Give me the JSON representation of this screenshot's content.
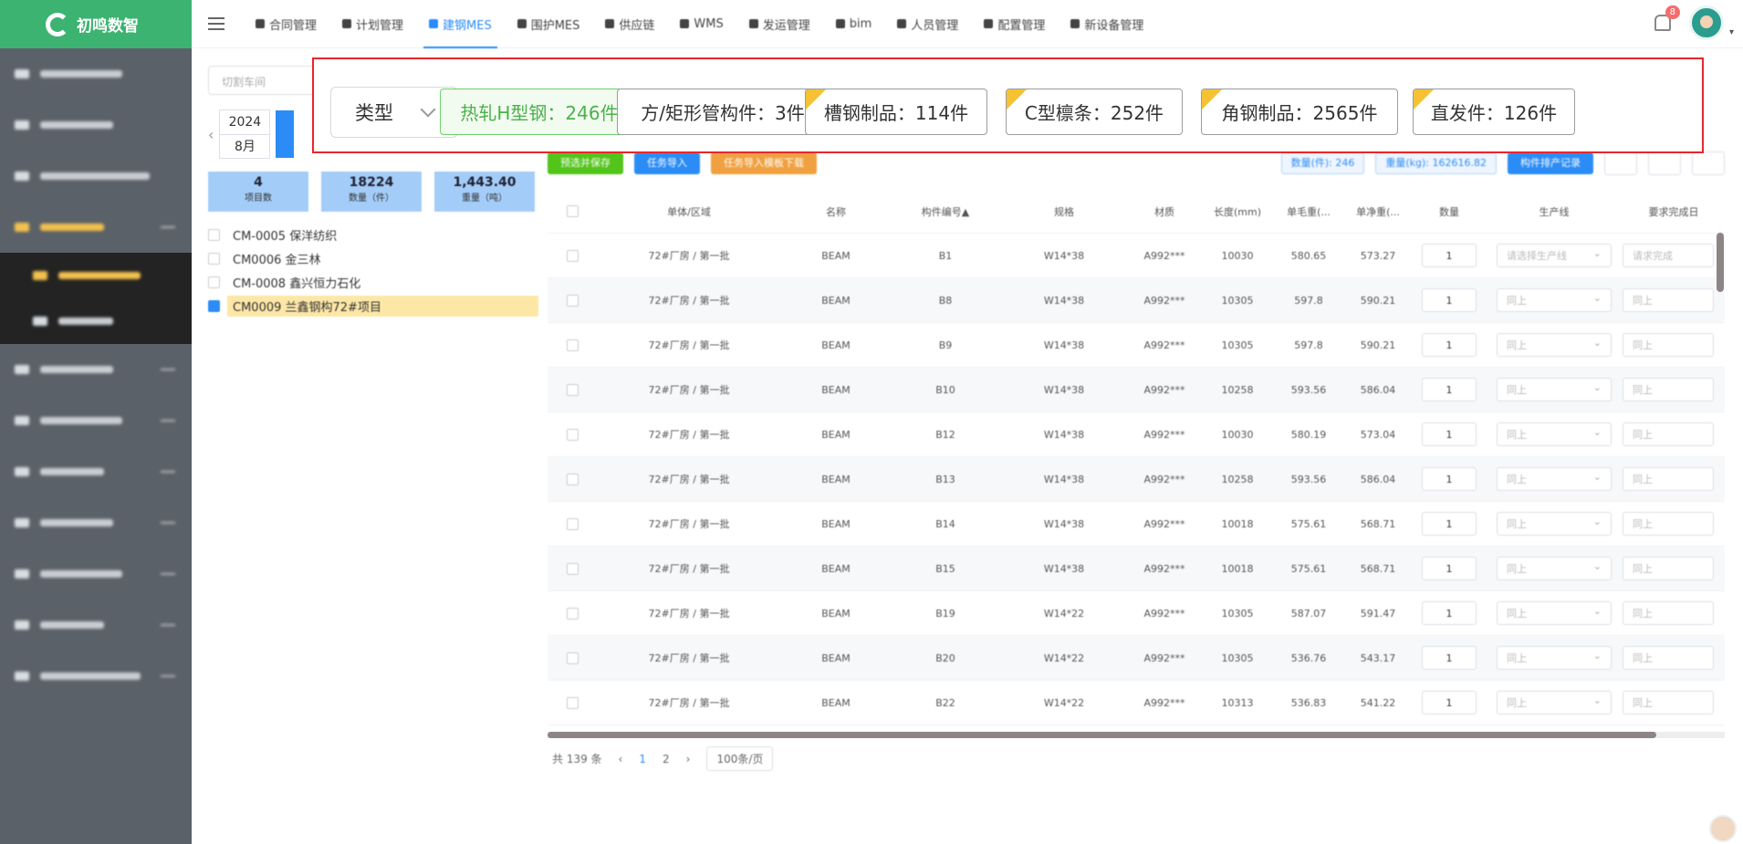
{
  "app": {
    "logo_text": "初鸣数智"
  },
  "sidebar": {
    "items": [
      {
        "label": "",
        "active": false
      },
      {
        "label": "",
        "active": false
      },
      {
        "label": "",
        "active": false
      },
      {
        "label": "",
        "active": true
      },
      {
        "label": "",
        "sub": true
      },
      {
        "label": "",
        "sub": true
      },
      {
        "label": "",
        "active": false
      },
      {
        "label": "",
        "active": false
      },
      {
        "label": "",
        "active": false
      },
      {
        "label": "",
        "active": false
      },
      {
        "label": "",
        "active": false
      },
      {
        "label": "",
        "active": false
      },
      {
        "label": "",
        "active": false
      }
    ]
  },
  "nav": {
    "tabs": [
      {
        "label": "合同管理",
        "icon": "contract-icon"
      },
      {
        "label": "计划管理",
        "icon": "plan-icon"
      },
      {
        "label": "建钢MES",
        "icon": "mes-icon",
        "active": true
      },
      {
        "label": "围护MES",
        "icon": "enclosure-icon"
      },
      {
        "label": "供应链",
        "icon": "supply-chain-icon"
      },
      {
        "label": "WMS",
        "icon": "warehouse-icon"
      },
      {
        "label": "发运管理",
        "icon": "truck-icon"
      },
      {
        "label": "bim",
        "icon": "bim-icon"
      },
      {
        "label": "人员管理",
        "icon": "people-icon"
      },
      {
        "label": "配置管理",
        "icon": "config-icon"
      },
      {
        "label": "新设备管理",
        "icon": "device-icon"
      }
    ],
    "notification_count": "8"
  },
  "left_panel": {
    "search_placeholder": "切割车间",
    "date": {
      "year": "2024",
      "month": "8月"
    },
    "stats": [
      {
        "value": "4",
        "label": "项目数"
      },
      {
        "value": "18224",
        "label": "数量（件）"
      },
      {
        "value": "1,443.40",
        "label": "重量（吨）"
      }
    ],
    "projects": [
      {
        "label": "CM-0005 保洋纺织",
        "checked": false
      },
      {
        "label": "CM0006 金三林",
        "checked": false
      },
      {
        "label": "CM-0008 鑫兴恒力石化",
        "checked": false
      },
      {
        "label": "CM0009 兰鑫钢构72#项目",
        "checked": true
      }
    ]
  },
  "filter": {
    "type_label": "类型",
    "categories": [
      {
        "label": "热轧H型钢：246件",
        "active": true,
        "corner": false
      },
      {
        "label": "方/矩形管构件：3件",
        "active": false,
        "corner": false
      },
      {
        "label": "槽钢制品：114件",
        "active": false,
        "corner": true
      },
      {
        "label": "C型檩条：252件",
        "active": false,
        "corner": true
      },
      {
        "label": "角钢制品：2565件",
        "active": false,
        "corner": true
      },
      {
        "label": "直发件：126件",
        "active": false,
        "corner": true
      }
    ]
  },
  "toolbar": {
    "buttons": [
      {
        "label": "预选并保存",
        "color": "#52c41a"
      },
      {
        "label": "任务导入",
        "color": "#2b8cf6"
      },
      {
        "label": "任务导入模板下载",
        "color": "#f0a040"
      }
    ],
    "count_tag": "数量(件): 246",
    "weight_tag": "重量(kg): 162616.82",
    "record_button": "构件排产记录"
  },
  "table": {
    "columns": [
      "",
      "单体/区域",
      "名称",
      "构件编号▲",
      "规格",
      "材质",
      "长度(mm)",
      "单毛重(...",
      "单净重(...",
      "数量",
      "生产线",
      "要求完成日"
    ],
    "rows": [
      [
        "72#厂房 / 第一批",
        "BEAM",
        "B1",
        "W14*38",
        "A992***",
        "10030",
        "580.65",
        "573.27",
        "1",
        "请选择生产线",
        "请求完成"
      ],
      [
        "72#厂房 / 第一批",
        "BEAM",
        "B8",
        "W14*38",
        "A992***",
        "10305",
        "597.8",
        "590.21",
        "1",
        "同上",
        "同上"
      ],
      [
        "72#厂房 / 第一批",
        "BEAM",
        "B9",
        "W14*38",
        "A992***",
        "10305",
        "597.8",
        "590.21",
        "1",
        "同上",
        "同上"
      ],
      [
        "72#厂房 / 第一批",
        "BEAM",
        "B10",
        "W14*38",
        "A992***",
        "10258",
        "593.56",
        "586.04",
        "1",
        "同上",
        "同上"
      ],
      [
        "72#厂房 / 第一批",
        "BEAM",
        "B12",
        "W14*38",
        "A992***",
        "10030",
        "580.19",
        "573.04",
        "1",
        "同上",
        "同上"
      ],
      [
        "72#厂房 / 第一批",
        "BEAM",
        "B13",
        "W14*38",
        "A992***",
        "10258",
        "593.56",
        "586.04",
        "1",
        "同上",
        "同上"
      ],
      [
        "72#厂房 / 第一批",
        "BEAM",
        "B14",
        "W14*38",
        "A992***",
        "10018",
        "575.61",
        "568.71",
        "1",
        "同上",
        "同上"
      ],
      [
        "72#厂房 / 第一批",
        "BEAM",
        "B15",
        "W14*38",
        "A992***",
        "10018",
        "575.61",
        "568.71",
        "1",
        "同上",
        "同上"
      ],
      [
        "72#厂房 / 第一批",
        "BEAM",
        "B19",
        "W14*22",
        "A992***",
        "10305",
        "587.07",
        "591.47",
        "1",
        "同上",
        "同上"
      ],
      [
        "72#厂房 / 第一批",
        "BEAM",
        "B20",
        "W14*22",
        "A992***",
        "10305",
        "536.76",
        "543.17",
        "1",
        "同上",
        "同上"
      ],
      [
        "72#厂房 / 第一批",
        "BEAM",
        "B22",
        "W14*22",
        "A992***",
        "10313",
        "536.83",
        "541.22",
        "1",
        "同上",
        "同上"
      ]
    ]
  },
  "pager": {
    "total": "共 139 条",
    "pages": [
      "1",
      "2"
    ],
    "current": "1",
    "page_size": "100条/页"
  }
}
